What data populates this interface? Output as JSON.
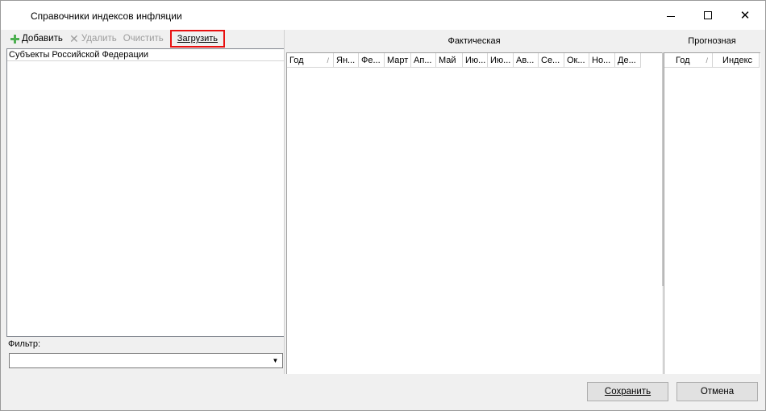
{
  "window": {
    "title": "Справочники индексов инфляции",
    "controls": {
      "minimize": "—",
      "maximize": "☐",
      "close": "✕"
    }
  },
  "toolbar": {
    "add_label": "Добавить",
    "delete_label": "Удалить",
    "clear_label": "Очистить",
    "load_label": "Загрузить"
  },
  "left": {
    "tree_header": "Субъекты Российской Федерации",
    "filter_label": "Фильтр:",
    "filter_value": ""
  },
  "actual": {
    "caption": "Фактическая",
    "columns": [
      "Год",
      "Ян...",
      "Фе...",
      "Март",
      "Ап...",
      "Май",
      "Ию...",
      "Ию...",
      "Ав...",
      "Се...",
      "Ок...",
      "Но...",
      "Де..."
    ],
    "sort_marker": "/"
  },
  "forecast": {
    "caption": "Прогнозная",
    "columns": [
      "Год",
      "Индекс"
    ],
    "sort_marker": "/"
  },
  "buttons": {
    "save_label": "Сохранить",
    "cancel_label": "Отмена"
  },
  "colors": {
    "highlight_border": "#e81010",
    "add_icon": "#4caf50"
  }
}
